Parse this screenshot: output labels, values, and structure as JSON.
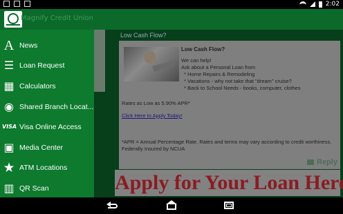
{
  "status_bar": {
    "time": "2:02"
  },
  "app_bar": {
    "title": "Magnify Credit Union"
  },
  "drawer": {
    "items": [
      {
        "label": "News",
        "icon": "news-icon"
      },
      {
        "label": "Loan Request",
        "icon": "list-icon"
      },
      {
        "label": "Calculators",
        "icon": "calculator-icon"
      },
      {
        "label": "Shared Branch Locat...",
        "icon": "wifi-icon"
      },
      {
        "label": "Visa Online Access",
        "icon": "visa-icon"
      },
      {
        "label": "Media Center",
        "icon": "film-icon"
      },
      {
        "label": "ATM Locations",
        "icon": "star-icon"
      },
      {
        "label": "QR Scan",
        "icon": "barcode-icon"
      }
    ]
  },
  "content": {
    "title": "Low Cash Flow?",
    "card": {
      "headline": "Low Cash Flow?",
      "body": "We can help!\nAsk about a Personal Loan from\n  * Home Repairs & Remodeling\n  * Vacations - why not take that \"dream\" cruise?\n  * Back to School Needs - books, computer, clothes",
      "rates": "Rates as Low as 5.90% APR*",
      "link": "Click Here to Apply Today!",
      "fine_print": "*APR = Annual Percentage Rate. Rates and terms may vary according to credit worthiness.\nFederally Insured by NCUA"
    },
    "reply_label": "Reply"
  },
  "banner": {
    "text": "Apply for Your Loan Here"
  }
}
